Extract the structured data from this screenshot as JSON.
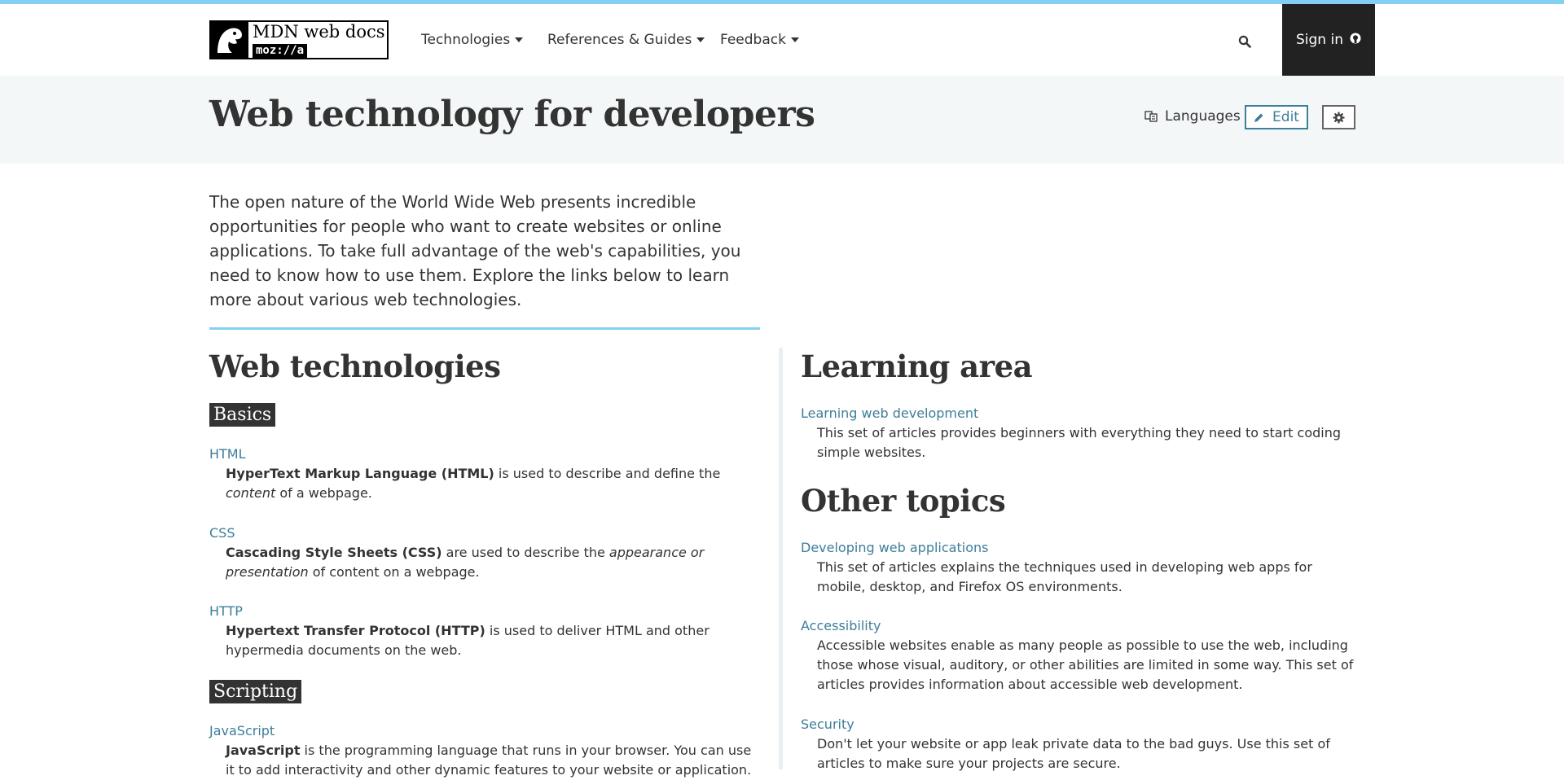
{
  "header": {
    "logo": {
      "title": "MDN web docs",
      "subtitle": "moz://a"
    },
    "nav": [
      {
        "label": "Technologies"
      },
      {
        "label": "References & Guides"
      },
      {
        "label": "Feedback"
      }
    ],
    "sign_in": "Sign in"
  },
  "page": {
    "title": "Web technology for developers",
    "languages": "Languages",
    "edit": "Edit"
  },
  "intro": "The open nature of the World Wide Web presents incredible opportunities for people who want to create websites or online applications. To take full advantage of the web's capabilities, you need to know how to use them. Explore the links below to learn more about various web technologies.",
  "web_tech": {
    "heading": "Web technologies",
    "basics_heading": "Basics",
    "html": {
      "term": "HTML",
      "strong": "HyperText Markup Language (HTML)",
      "pre": " is used to describe and define the ",
      "em": "content",
      "post": " of a webpage."
    },
    "css": {
      "term": "CSS",
      "strong": "Cascading Style Sheets (CSS)",
      "pre": " are used to describe the ",
      "em": "appearance or presentation",
      "post": " of content on a webpage."
    },
    "http": {
      "term": "HTTP",
      "strong": "Hypertext Transfer Protocol (HTTP)",
      "post": " is used to deliver HTML and other hypermedia documents on the web."
    },
    "scripting_heading": "Scripting",
    "javascript": {
      "term": "JavaScript",
      "strong": "JavaScript",
      "post": " is the programming language that runs in your browser. You can use it to add interactivity and other dynamic features to your website or application."
    }
  },
  "learning": {
    "heading": "Learning area",
    "item": {
      "term": "Learning web development",
      "desc": "This set of articles provides beginners with everything they need to start coding simple websites."
    }
  },
  "other": {
    "heading": "Other topics",
    "items": [
      {
        "term": "Developing web applications",
        "desc": "This set of articles explains the techniques used in developing web apps for mobile, desktop, and Firefox OS environments."
      },
      {
        "term": "Accessibility",
        "desc": "Accessible websites enable as many people as possible to use the web, including those whose visual, auditory, or other abilities are limited in some way. This set of articles provides information about accessible web development."
      },
      {
        "term": "Security",
        "desc": "Don't let your website or app leak private data to the bad guys. Use this set of articles to make sure your projects are secure."
      }
    ]
  },
  "colors": {
    "accent_bar": "#83d0f2",
    "link": "#3d7e9a",
    "title_band": "#f4f7f8",
    "sign_in_bg": "#222222"
  },
  "icons": [
    "mdn-logo-icon",
    "caret-down-icon",
    "search-icon",
    "github-icon",
    "languages-icon",
    "pencil-icon",
    "gear-icon"
  ]
}
